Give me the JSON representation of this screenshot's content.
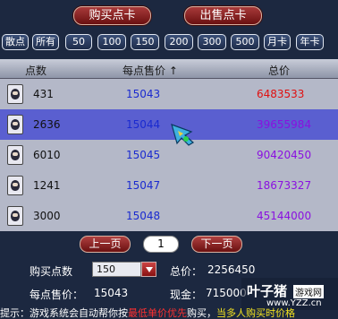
{
  "top_buttons": {
    "buy": "购买点卡",
    "sell": "出售点卡"
  },
  "filters": [
    "散点",
    "所有",
    "50",
    "100",
    "150",
    "200",
    "300",
    "500",
    "月卡",
    "年卡"
  ],
  "headers": {
    "points": "点数",
    "unit_price": "每点售价",
    "sort_arrow": "↑",
    "total": "总价"
  },
  "rows": [
    {
      "points": "431",
      "unit_price": "15043",
      "total": "6483533",
      "total_color": "#e01010",
      "selected": false
    },
    {
      "points": "2636",
      "unit_price": "15044",
      "total": "39655984",
      "total_color": "#8a10e0",
      "selected": true
    },
    {
      "points": "6010",
      "unit_price": "15045",
      "total": "90420450",
      "total_color": "#8a10e0",
      "selected": false
    },
    {
      "points": "1241",
      "unit_price": "15047",
      "total": "18673327",
      "total_color": "#8a10e0",
      "selected": false
    },
    {
      "points": "3000",
      "unit_price": "15048",
      "total": "45144000",
      "total_color": "#8a10e0",
      "selected": false
    }
  ],
  "pager": {
    "prev": "上一页",
    "page": "1",
    "next": "下一页"
  },
  "purchase": {
    "qty_label": "购买点数",
    "qty_value": "150",
    "total_label": "总价：",
    "total_value": "2256450",
    "unit_label": "每点售价：",
    "unit_value": "15043",
    "cash_label": "现金：",
    "cash_value": "715000"
  },
  "tip": {
    "prefix": "提示：游戏系统会自动帮你按",
    "highlight": "最低单价优先",
    "middle": "购买，",
    "warn": "当多人购买时价格"
  },
  "watermark": {
    "brand": "叶子猪",
    "badge": "游戏网",
    "url": "www.YZZ.cn"
  },
  "icons": {
    "row_icon": "point-card-icon",
    "cursor": "cursor-icon",
    "dropdown": "chevron-down-icon"
  }
}
